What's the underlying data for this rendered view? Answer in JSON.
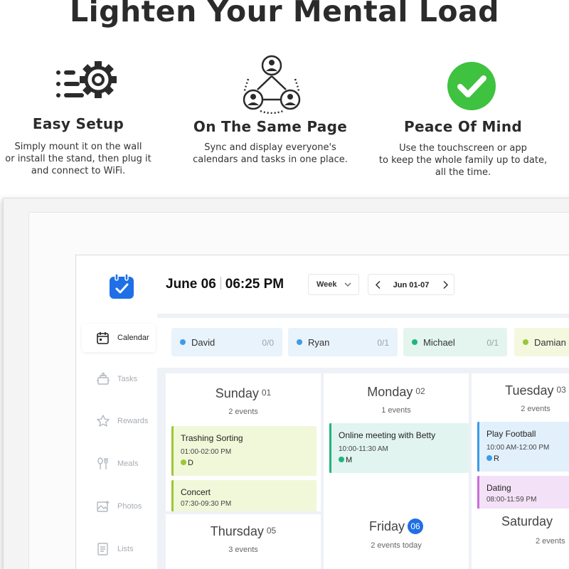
{
  "headline": "Lighten Your Mental Load",
  "features": [
    {
      "icon": "gear-list-icon",
      "title": "Easy Setup",
      "lines": [
        "Simply mount it on the wall",
        "or install the stand, then plug it",
        "and connect to WiFi."
      ]
    },
    {
      "icon": "people-network-icon",
      "title": "On The Same Page",
      "lines": [
        "Sync and display everyone's",
        "calendars and tasks in one place."
      ]
    },
    {
      "icon": "checkmark-circle-icon",
      "title": "Peace Of Mind",
      "lines": [
        "Use the touchscreen or app",
        "to keep the whole family up to date,",
        "all the time."
      ]
    }
  ],
  "colors": {
    "accent_blue": "#1f6fe6",
    "check_green": "#3fc23f",
    "david": "#3d9be9",
    "ryan": "#3d9be9",
    "michael": "#22b37c",
    "damian": "#9bc63a"
  },
  "app": {
    "sidebar": [
      {
        "icon": "calendar-icon",
        "label": "Calendar",
        "active": true
      },
      {
        "icon": "tasks-icon",
        "label": "Tasks",
        "active": false
      },
      {
        "icon": "rewards-icon",
        "label": "Rewards",
        "active": false
      },
      {
        "icon": "meals-icon",
        "label": "Meals",
        "active": false
      },
      {
        "icon": "photos-icon",
        "label": "Photos",
        "active": false
      },
      {
        "icon": "lists-icon",
        "label": "Lists",
        "active": false
      }
    ],
    "header": {
      "date": "June 06",
      "time": "06:25 PM",
      "view": "Week",
      "range": "Jun 01-07"
    },
    "members": [
      {
        "name": "David",
        "count": "0/0"
      },
      {
        "name": "Ryan",
        "count": "0/1"
      },
      {
        "name": "Michael",
        "count": "0/1"
      },
      {
        "name": "Damian",
        "count": ""
      }
    ],
    "days": [
      {
        "name": "Sunday",
        "num": "01",
        "sub": "2 events",
        "events": [
          {
            "title": "Trashing Sorting",
            "time": "01:00-02:00 PM",
            "owner": "D"
          },
          {
            "title": "Concert",
            "time": "07:30-09:30 PM",
            "owner": ""
          }
        ]
      },
      {
        "name": "Monday",
        "num": "02",
        "sub": "1 events",
        "events": [
          {
            "title": "Online meeting with Betty",
            "time": "10:00-11:30 AM",
            "owner": "M"
          }
        ]
      },
      {
        "name": "Tuesday",
        "num": "03",
        "sub": "2 events",
        "events": [
          {
            "title": "Play Football",
            "time": "10:00 AM-12:00 PM",
            "owner": "R"
          },
          {
            "title": "Dating",
            "time": "08:00-11:59 PM",
            "owner": ""
          }
        ]
      },
      {
        "name": "Thursday",
        "num": "05",
        "sub": "3 events",
        "events": []
      },
      {
        "name": "Friday",
        "num": "06",
        "sub": "2 events today",
        "events": []
      },
      {
        "name": "Saturday",
        "num": "",
        "sub": "2 events",
        "events": []
      }
    ]
  }
}
